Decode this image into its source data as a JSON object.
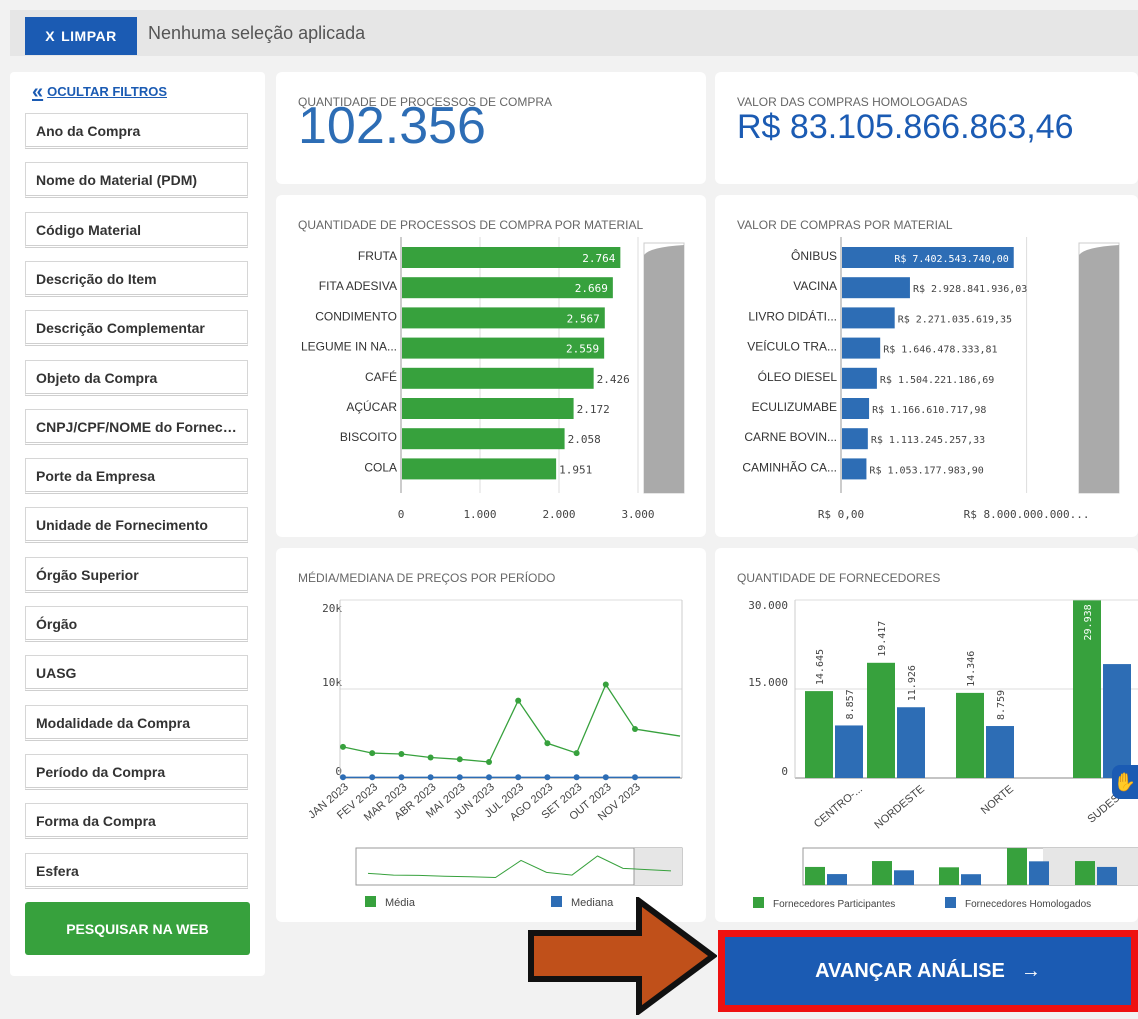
{
  "topbar": {
    "clear_label": "LIMPAR",
    "clear_icon": "X",
    "status": "Nenhuma seleção aplicada"
  },
  "sidebar": {
    "hide_label": "OCULTAR FILTROS",
    "filters": [
      "Ano da Compra",
      "Nome do Material (PDM)",
      "Código Material",
      "Descrição do Item",
      "Descrição Complementar",
      "Objeto da Compra",
      "CNPJ/CPF/NOME do Fornecedor",
      "Porte da Empresa",
      "Unidade de Fornecimento",
      "Órgão Superior",
      "Órgão",
      "UASG",
      "Modalidade da Compra",
      "Período da Compra",
      "Forma da Compra",
      "Esfera"
    ],
    "search_label": "PESQUISAR NA WEB"
  },
  "kpis": {
    "processes": {
      "title": "QUANTIDADE DE PROCESSOS DE COMPRA",
      "value": "102.356"
    },
    "value": {
      "title": "VALOR DAS COMPRAS HOMOLOGADAS",
      "value": "R$ 83.105.866.863,46"
    }
  },
  "next_button": {
    "label": "AVANÇAR ANÁLISE",
    "arrow": "→"
  },
  "colors": {
    "blue": "#1b5bb3",
    "green": "#37a13d",
    "bar_blue": "#2d6db5",
    "red": "#ee1111",
    "arrow": "#c0501a"
  },
  "chart_data": [
    {
      "type": "bar",
      "orientation": "horizontal",
      "title": "QUANTIDADE DE PROCESSOS DE COMPRA POR MATERIAL",
      "categories": [
        "FRUTA",
        "FITA ADESIVA",
        "CONDIMENTO",
        "LEGUME IN NA...",
        "CAFÉ",
        "AÇÚCAR",
        "BISCOITO",
        "COLA"
      ],
      "values": [
        2764,
        2669,
        2567,
        2559,
        2426,
        2172,
        2058,
        1951
      ],
      "value_labels": [
        "2.764",
        "2.669",
        "2.567",
        "2.559",
        "2.426",
        "2.172",
        "2.058",
        "1.951"
      ],
      "xlim": [
        0,
        3000
      ],
      "ticks": [
        "0",
        "1.000",
        "2.000",
        "3.000"
      ],
      "color": "#37a13d"
    },
    {
      "type": "bar",
      "orientation": "horizontal",
      "title": "VALOR DE COMPRAS POR MATERIAL",
      "categories": [
        "ÔNIBUS",
        "VACINA",
        "LIVRO DIDÁTI...",
        "VEÍCULO TRA...",
        "ÓLEO DIESEL",
        "ECULIZUMABE",
        "CARNE BOVIN...",
        "CAMINHÃO CA..."
      ],
      "values": [
        7402543740.0,
        2928841936.03,
        2271035619.35,
        1646478333.81,
        1504221186.69,
        1166610717.98,
        1113245257.33,
        1053177983.9
      ],
      "value_labels": [
        "R$ 7.402.543.740,00",
        "R$ 2.928.841.936,03",
        "R$ 2.271.035.619,35",
        "R$ 1.646.478.333,81",
        "R$ 1.504.221.186,69",
        "R$ 1.166.610.717,98",
        "R$ 1.113.245.257,33",
        "R$ 1.053.177.983,90"
      ],
      "xlim": [
        0,
        10000000000
      ],
      "ticks": [
        "R$ 0,00",
        "R$ 8.000.000.000..."
      ],
      "color": "#2d6db5"
    },
    {
      "type": "line",
      "title": "MÉDIA/MEDIANA DE PREÇOS POR PERÍODO",
      "categories": [
        "JAN 2023",
        "FEV 2023",
        "MAR 2023",
        "ABR 2023",
        "MAI 2023",
        "JUN 2023",
        "JUL 2023",
        "AGO 2023",
        "SET 2023",
        "OUT 2023",
        "NOV 2023"
      ],
      "series": [
        {
          "name": "Média",
          "color": "#37a13d",
          "values": [
            3500,
            2800,
            2700,
            2300,
            2100,
            1800,
            8700,
            3900,
            2800,
            10500,
            5500
          ]
        },
        {
          "name": "Mediana",
          "color": "#2d6db5",
          "values": [
            80,
            80,
            80,
            80,
            80,
            80,
            80,
            80,
            80,
            80,
            80
          ]
        }
      ],
      "ylim": [
        0,
        20000
      ],
      "yticks": [
        "0",
        "10k",
        "20k"
      ]
    },
    {
      "type": "bar",
      "title": "QUANTIDADE DE FORNECEDORES",
      "categories": [
        "CENTRO-...",
        "NORDESTE",
        "NORTE",
        "SUDESTE"
      ],
      "series": [
        {
          "name": "Fornecedores Participantes",
          "color": "#37a13d",
          "values": [
            14645,
            19417,
            14346,
            29938
          ],
          "labels": [
            "14.645",
            "19.417",
            "14.346",
            "29.938"
          ]
        },
        {
          "name": "Fornecedores Homologados",
          "color": "#2d6db5",
          "values": [
            8857,
            11926,
            8759,
            19200
          ],
          "labels": [
            "8.857",
            "11.926",
            "8.759",
            ""
          ]
        }
      ],
      "ylim": [
        0,
        30000
      ],
      "yticks": [
        "0",
        "15.000",
        "30.000"
      ]
    }
  ]
}
